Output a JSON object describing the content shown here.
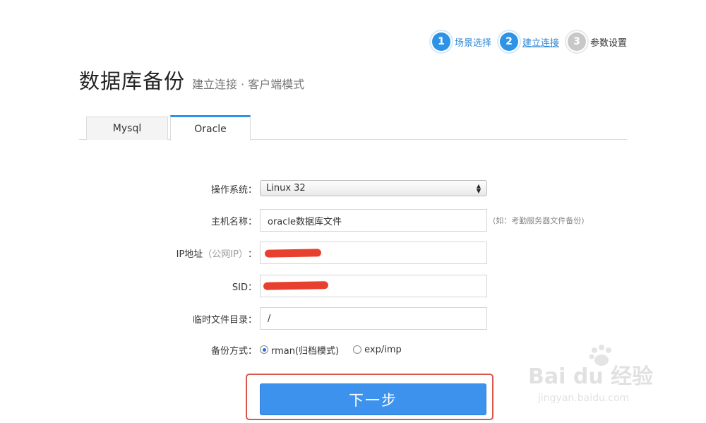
{
  "steps": [
    {
      "num": "1",
      "label": "场景选择",
      "state": "done"
    },
    {
      "num": "2",
      "label": "建立连接",
      "state": "current"
    },
    {
      "num": "3",
      "label": "参数设置",
      "state": "pending"
    }
  ],
  "header": {
    "title": "数据库备份",
    "subtitle": "建立连接 · 客户端模式"
  },
  "tabs": [
    {
      "label": "Mysql",
      "active": false
    },
    {
      "label": "Oracle",
      "active": true
    }
  ],
  "form": {
    "os": {
      "label": "操作系统：",
      "value": "Linux 32"
    },
    "host": {
      "label": "主机名称：",
      "value": "oracle数据库文件",
      "hint": "(如：考勤服务器文件备份)"
    },
    "ip": {
      "label_main": "IP地址",
      "label_note": "（公网IP）",
      "label_colon": "："
    },
    "sid": {
      "label": "SID："
    },
    "temp_dir": {
      "label": "临时文件目录：",
      "value": "/"
    },
    "backup_mode": {
      "label": "备份方式：",
      "options": [
        {
          "label": "rman(归档模式)",
          "checked": true
        },
        {
          "label": "exp/imp",
          "checked": false
        }
      ]
    }
  },
  "next_button": {
    "label": "下一步"
  },
  "watermark": {
    "logo": "Bai du 经验",
    "url": "jingyan.baidu.com"
  },
  "colors": {
    "accent": "#2e93e6",
    "button": "#3c92ec",
    "highlight": "#d9574a",
    "redaction": "#e8402f"
  }
}
